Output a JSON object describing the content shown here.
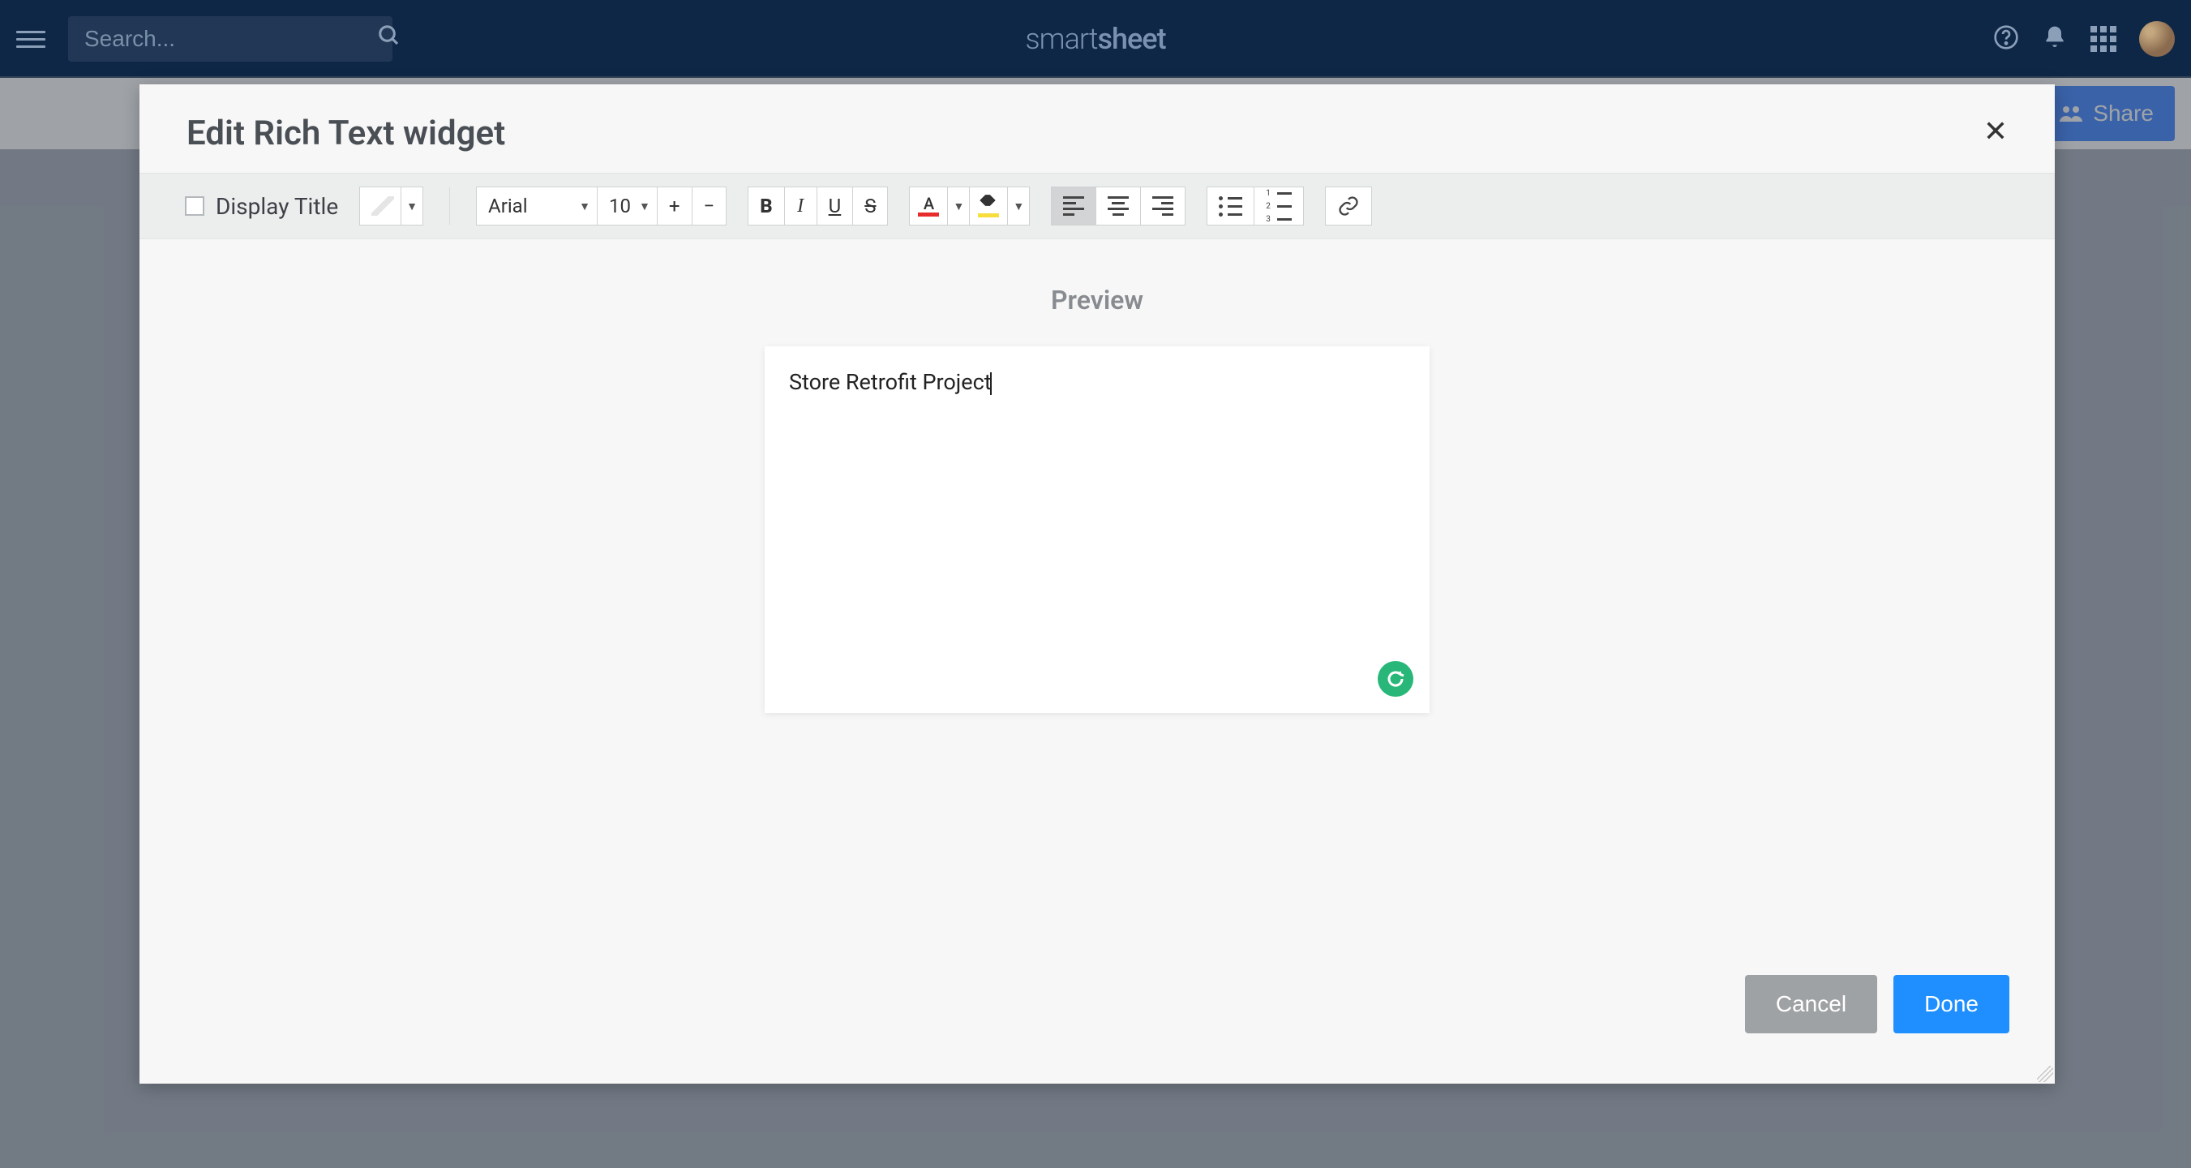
{
  "nav": {
    "search_placeholder": "Search...",
    "logo_text_1": "smart",
    "logo_text_2": "sheet"
  },
  "share_button": {
    "label": "Share"
  },
  "modal": {
    "title": "Edit Rich Text widget",
    "display_title_label": "Display Title",
    "display_title_checked": false,
    "font_family": "Arial",
    "font_size": "10",
    "preview_label": "Preview",
    "preview_text": "Store Retrofit Project",
    "cancel_label": "Cancel",
    "done_label": "Done"
  },
  "toolbar": {
    "bold": "B",
    "italic": "I",
    "underline": "U",
    "strike": "S",
    "text_color_letter": "A",
    "plus": "+",
    "minus": "−"
  }
}
